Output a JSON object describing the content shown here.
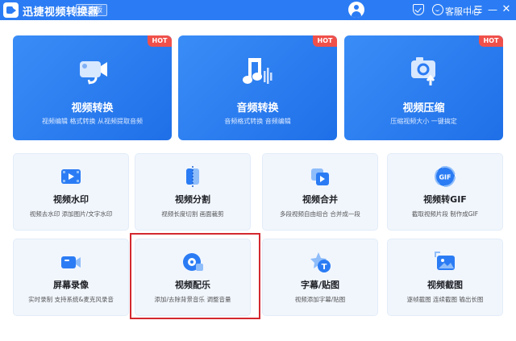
{
  "app": {
    "title": "迅捷视频转换器",
    "edition": "极速版",
    "service_label": "客服中心"
  },
  "feature_cards": [
    {
      "title": "视频转换",
      "desc": "视频编辑 格式转换 从视频提取音频",
      "badge": "HOT",
      "icon": "video-convert-icon"
    },
    {
      "title": "音频转换",
      "desc": "音频格式转换 音频编辑",
      "badge": "HOT",
      "icon": "audio-convert-icon"
    },
    {
      "title": "视频压缩",
      "desc": "压缩视频大小 一键搞定",
      "badge": "HOT",
      "icon": "video-compress-icon"
    }
  ],
  "tools": [
    {
      "title": "视频水印",
      "desc": "视频去水印 添加图片/文字水印",
      "icon": "watermark-icon"
    },
    {
      "title": "视频分割",
      "desc": "视频长度切割 画面裁剪",
      "icon": "split-icon"
    },
    {
      "title": "视频合并",
      "desc": "多段视频自由组合 合并成一段",
      "icon": "merge-icon"
    },
    {
      "title": "视频转GIF",
      "desc": "截取视频片段 制作成GIF",
      "icon": "gif-icon",
      "icon_text": "GIF"
    },
    {
      "title": "屏幕录像",
      "desc": "实时录制 支持系统&麦克风录音",
      "icon": "screen-record-icon"
    },
    {
      "title": "视频配乐",
      "desc": "添加/去除背景音乐 调整音量",
      "icon": "music-icon"
    },
    {
      "title": "字幕/贴图",
      "desc": "视频添加字幕/贴图",
      "icon": "subtitle-sticker-icon",
      "icon_text": "T"
    },
    {
      "title": "视频截图",
      "desc": "逐帧截图 连续截图 输出长图",
      "icon": "screenshot-icon"
    }
  ],
  "colors": {
    "titlebar": "#2b7cf4",
    "card_blue": "#1f6fe8",
    "hot_badge": "#f0504a",
    "highlight": "#d4282f",
    "tool_bg": "#f1f6fd"
  }
}
